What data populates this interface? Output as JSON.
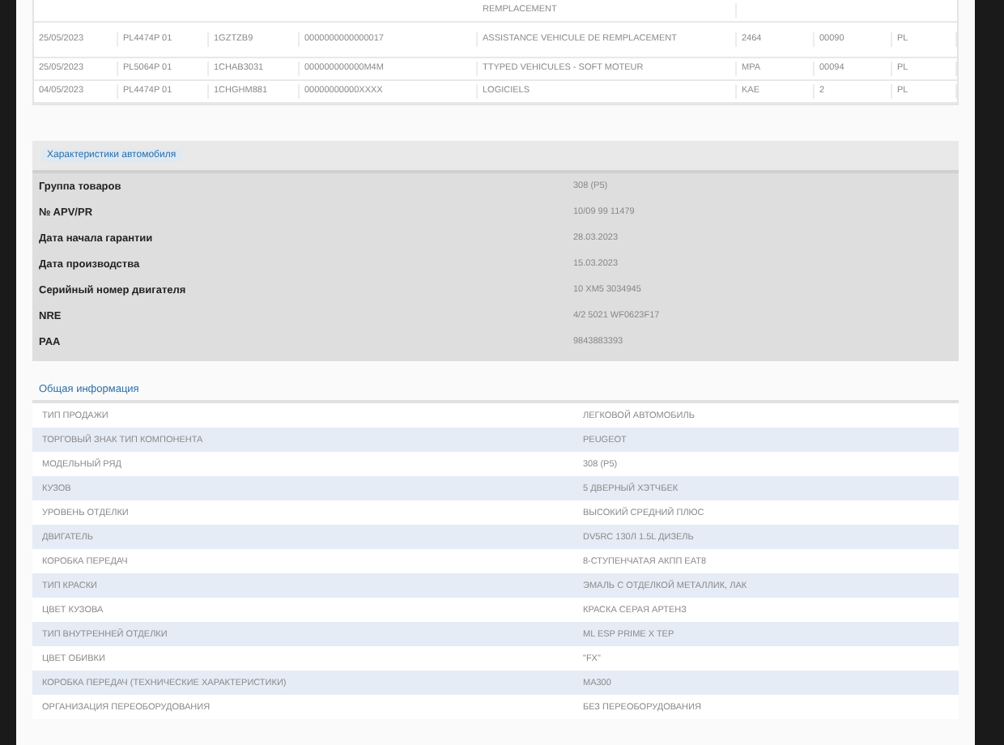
{
  "history_table": {
    "rows": [
      {
        "cells": [
          "",
          "",
          "",
          "",
          "REMPLACEMENT",
          "",
          "",
          ""
        ]
      },
      {
        "cells": [
          "25/05/2023",
          "PL4474P 01",
          "1GZTZB9",
          "0000000000000017",
          "ASSISTANCE VEHICULE DE REMPLACEMENT",
          "2464",
          "00090",
          "PL"
        ]
      },
      {
        "cells": [
          "25/05/2023",
          "PL5064P 01",
          "1CHAB3031",
          "000000000000M4M",
          "TTYPED VEHICULES - SOFT MOTEUR",
          "MPA",
          "00094",
          "PL"
        ]
      },
      {
        "cells": [
          "04/05/2023",
          "PL4474P 01",
          "1CHGHM881",
          "00000000000XXXX",
          "LOGICIELS",
          "KAE",
          "2",
          "PL"
        ]
      }
    ]
  },
  "vehicle_panel": {
    "title": "Характеристики автомобиля",
    "rows": [
      {
        "label": "Группа товаров",
        "value": "308 (P5)"
      },
      {
        "label": "№ APV/PR",
        "value": "10/09 99 11479"
      },
      {
        "label": "Дата начала гарантии",
        "value": "28.03.2023"
      },
      {
        "label": "Дата производства",
        "value": "15.03.2023"
      },
      {
        "label": "Серийный номер двигателя",
        "value": "10 XM5 3034945"
      },
      {
        "label": "NRE",
        "value": "4/2 5021 WF0623F17"
      },
      {
        "label": "PAA",
        "value": "9843883393"
      }
    ]
  },
  "general_info": {
    "title": "Общая информация",
    "rows": [
      {
        "label": "ТИП ПРОДАЖИ",
        "value": "ЛЕГКОВОЙ АВТОМОБИЛЬ"
      },
      {
        "label": "ТОРГОВЫЙ ЗНАК ТИП КОМПОНЕНТА",
        "value": "PEUGEOT"
      },
      {
        "label": "МОДЕЛЬНЫЙ РЯД",
        "value": "308 (P5)"
      },
      {
        "label": "КУЗОВ",
        "value": "5 ДВЕРНЫЙ ХЭТЧБЕК"
      },
      {
        "label": "УРОВЕНЬ ОТДЕЛКИ",
        "value": "ВЫСОКИЙ СРЕДНИЙ ПЛЮС"
      },
      {
        "label": "ДВИГАТЕЛЬ",
        "value": "DV5RC 130Л 1.5L ДИЗЕЛЬ"
      },
      {
        "label": "КОРОБКА ПЕРЕДАЧ",
        "value": "8-СТУПЕНЧАТАЯ АКПП EAT8"
      },
      {
        "label": "ТИП КРАСКИ",
        "value": "ЭМАЛЬ С ОТДЕЛКОЙ МЕТАЛЛИК, ЛАК"
      },
      {
        "label": "ЦВЕТ КУЗОВА",
        "value": "КРАСКА СЕРАЯ АРТЕНЗ"
      },
      {
        "label": "ТИП ВНУТРЕННЕЙ ОТДЕЛКИ",
        "value": "ML ESP PRIME X TEP"
      },
      {
        "label": "ЦВЕТ ОБИВКИ",
        "value": "\"FX\""
      },
      {
        "label": "КОРОБКА ПЕРЕДАЧ (ТЕХНИЧЕСКИЕ ХАРАКТЕРИСТИКИ)",
        "value": "MA300"
      },
      {
        "label": "ОРГАНИЗАЦИЯ ПЕРЕОБОРУДОВАНИЯ",
        "value": "БЕЗ ПЕРЕОБОРУДОВАНИЯ"
      }
    ]
  }
}
